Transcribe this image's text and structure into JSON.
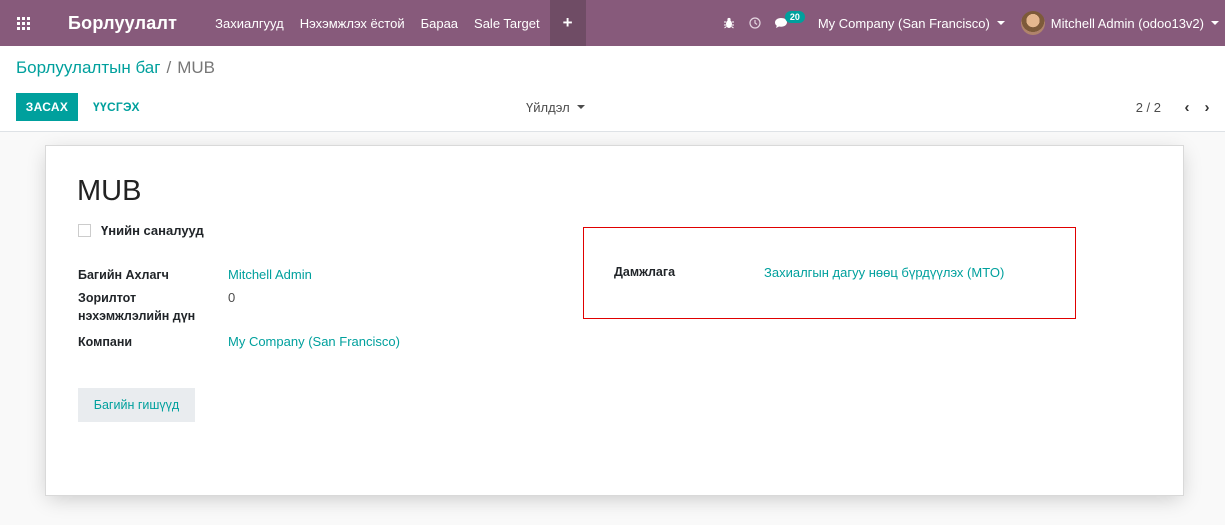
{
  "navbar": {
    "brand": "Борлуулалт",
    "menu": [
      "Захиалгууд",
      "Нэхэмжлэх ёстой",
      "Бараа",
      "Sale Target"
    ],
    "plus": "+",
    "chat_badge": "20",
    "company": "My Company (San Francisco)",
    "user": "Mitchell Admin (odoo13v2)"
  },
  "breadcrumb": {
    "parent": "Борлуулалтын баг",
    "separator": "/",
    "current": "MUB"
  },
  "buttons": {
    "edit": "ЗАСАХ",
    "create": "ҮҮСГЭХ",
    "action": "Үйлдэл"
  },
  "pager": {
    "value": "2 / 2",
    "prev": "‹",
    "next": "›"
  },
  "form": {
    "title": "MUB",
    "checkbox_label": "Үнийн саналууд",
    "fields": [
      {
        "label": "Багийн Ахлагч",
        "value": "Mitchell Admin"
      },
      {
        "label": "Зорилтот нэхэмжлэлийн дүн",
        "value": "0"
      },
      {
        "label": "Компани",
        "value": "My Company (San Francisco)"
      }
    ],
    "members_button": "Багийн гишүүд",
    "route": {
      "label": "Дамжлага",
      "value": "Захиалгын дагуу нөөц бүрдүүлэх (MTO)"
    }
  },
  "colors": {
    "navbar": "#875a7b",
    "accent": "#00a09d",
    "highlight_box": "#e00000"
  }
}
